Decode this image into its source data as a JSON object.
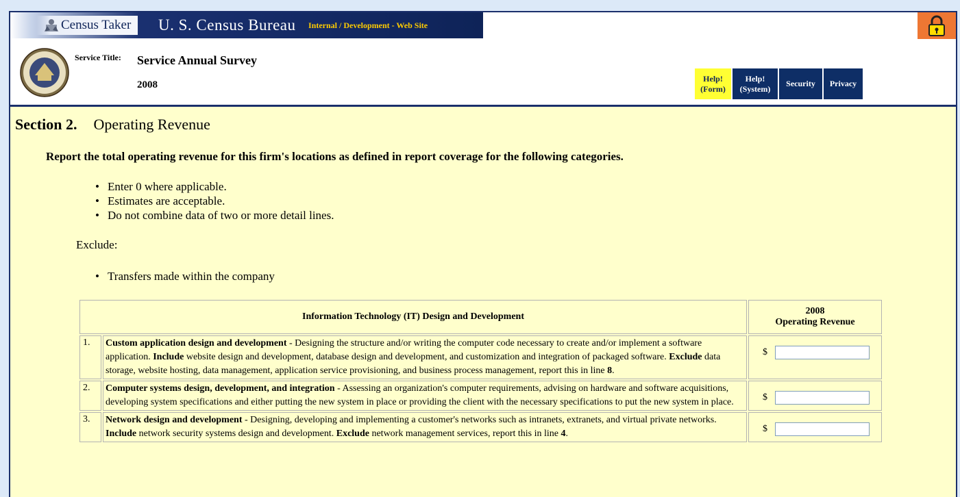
{
  "banner": {
    "census_taker": "Census Taker",
    "bureau": "U. S. Census Bureau",
    "site_notice": "Internal / Development - Web Site"
  },
  "service": {
    "label": "Service Title:",
    "title": "Service Annual Survey",
    "year": "2008"
  },
  "nav": {
    "help_form": [
      "Help!",
      "(Form)"
    ],
    "help_system": [
      "Help!",
      "(System)"
    ],
    "security": "Security",
    "privacy": "Privacy"
  },
  "section": {
    "number": "Section 2.",
    "title": "Operating Revenue"
  },
  "instructions": "Report the total operating revenue for this firm's locations as defined in report coverage for the following categories.",
  "bullets": [
    "Enter 0 where applicable.",
    "Estimates are acceptable.",
    "Do not combine data of two or more detail lines."
  ],
  "exclude": {
    "label": "Exclude:",
    "items": [
      "Transfers made within the company"
    ]
  },
  "table": {
    "header_category": "Information Technology (IT) Design and Development",
    "header_year": "2008",
    "header_revenue": "Operating Revenue",
    "currency": "$",
    "rows": [
      {
        "num": "1.",
        "segments": [
          {
            "b": true,
            "t": "Custom application design and development"
          },
          {
            "b": false,
            "t": " - Designing the structure and/or writing the computer code necessary to create and/or implement a software application. "
          },
          {
            "b": true,
            "t": "Include"
          },
          {
            "b": false,
            "t": " website design and development, database design and development, and customization and integration of packaged software. "
          },
          {
            "b": true,
            "t": "Exclude"
          },
          {
            "b": false,
            "t": " data storage, website hosting, data management, application service provisioning, and business process management, report this in line "
          },
          {
            "b": true,
            "t": "8"
          },
          {
            "b": false,
            "t": "."
          }
        ],
        "value": ""
      },
      {
        "num": "2.",
        "segments": [
          {
            "b": true,
            "t": "Computer systems design, development, and integration"
          },
          {
            "b": false,
            "t": " - Assessing an organization's computer requirements, advising on hardware and software acquisitions, developing system specifications and either putting the new system in place or providing the client with the necessary specifications to put the new system in place."
          }
        ],
        "value": ""
      },
      {
        "num": "3.",
        "segments": [
          {
            "b": true,
            "t": "Network design and development"
          },
          {
            "b": false,
            "t": " - Designing, developing and implementing a customer's networks such as intranets, extranets, and virtual private networks. "
          },
          {
            "b": true,
            "t": "Include"
          },
          {
            "b": false,
            "t": " network security systems design and development. "
          },
          {
            "b": true,
            "t": "Exclude"
          },
          {
            "b": false,
            "t": " network management services, report this in line "
          },
          {
            "b": true,
            "t": "4"
          },
          {
            "b": false,
            "t": "."
          }
        ],
        "value": ""
      }
    ]
  },
  "colors": {
    "navy": "#0e2e66",
    "content_bg": "#ffffcc",
    "help_form_bg": "#ffff33",
    "lock_bg": "#ee7733",
    "notice": "#ffcc00"
  },
  "icons": {
    "census_taker": "census-taker-icon",
    "lock": "lock-icon",
    "seal": "department-of-commerce-seal"
  }
}
